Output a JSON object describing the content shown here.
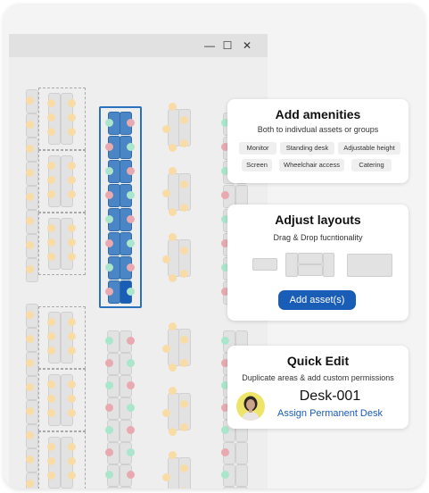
{
  "window": {
    "controls": {
      "minimize": "—",
      "maximize": "☐",
      "close": "✕"
    }
  },
  "amenities_card": {
    "title": "Add amenities",
    "subtitle": "Both to indivdual assets or groups",
    "chips": [
      "Monitor",
      "Standing desk",
      "Adjustable height",
      "Screen",
      "Wheelchair access",
      "Catering"
    ]
  },
  "layouts_card": {
    "title": "Adjust layouts",
    "subtitle": "Drag & Drop fucntionality",
    "button_label": "Add asset(s)"
  },
  "quick_edit_card": {
    "title": "Quick Edit",
    "subtitle": "Duplicate areas & add custom permissions",
    "desk_name": "Desk-001",
    "assign_link": "Assign Permanent Desk"
  },
  "colors": {
    "accent": "#1a5db6",
    "selection_border": "#2a72c0",
    "selected_desk": "#4a86c5",
    "seat_available": "#f9dba6",
    "seat_occupied": "#e8aab0",
    "seat_free": "#a9e6cb"
  }
}
